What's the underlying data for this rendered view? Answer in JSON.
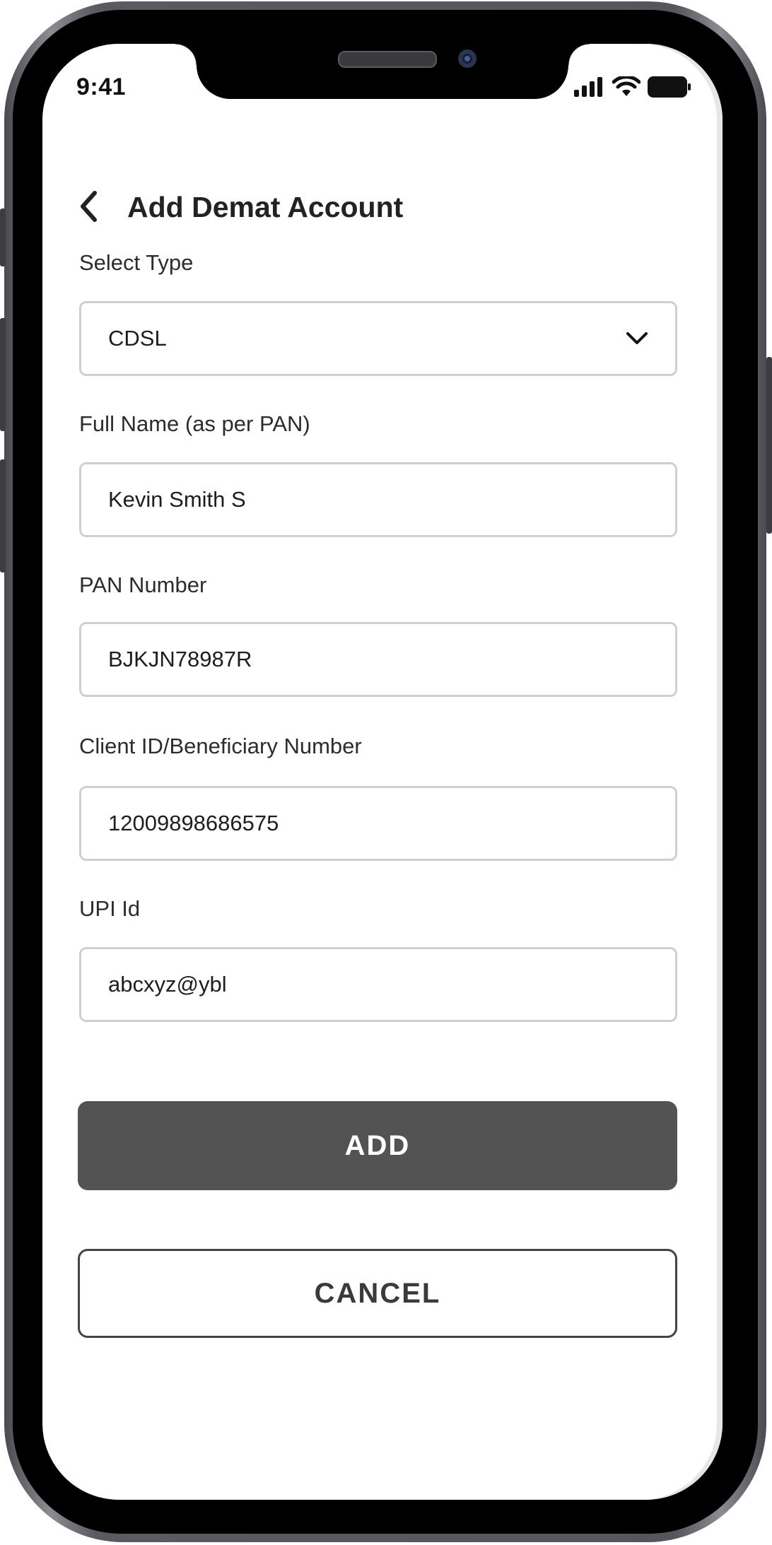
{
  "status_bar": {
    "time": "9:41",
    "icons": [
      "cellular-signal-icon",
      "wifi-icon",
      "battery-icon"
    ]
  },
  "header": {
    "back_icon": "chevron-left-icon",
    "title": "Add Demat Account"
  },
  "form": {
    "select_type": {
      "label": "Select Type",
      "value": "CDSL",
      "icon": "chevron-down-icon"
    },
    "full_name": {
      "label": "Full Name (as per PAN)",
      "value": "Kevin Smith S"
    },
    "pan_number": {
      "label": "PAN Number",
      "value": "BJKJN78987R"
    },
    "client_id": {
      "label": "Client ID/Beneficiary Number",
      "value": "12009898686575"
    },
    "upi_id": {
      "label": "UPI Id",
      "value": "abcxyz@ybl"
    }
  },
  "actions": {
    "add_label": "ADD",
    "cancel_label": "CANCEL"
  },
  "colors": {
    "primary_button": "#535353",
    "field_border": "#cfcfcf",
    "text": "#222222"
  }
}
